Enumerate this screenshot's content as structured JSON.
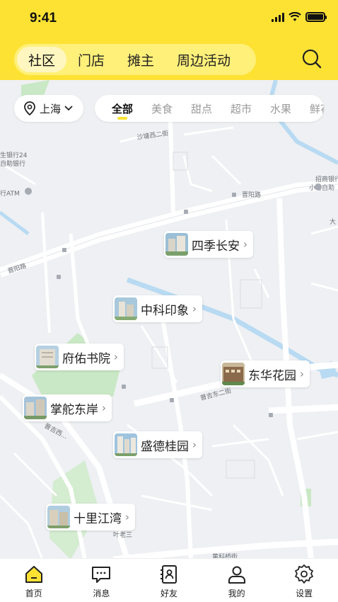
{
  "status_bar": {
    "time": "9:41"
  },
  "top_tabs": [
    {
      "label": "社区",
      "active": true
    },
    {
      "label": "门店",
      "active": false
    },
    {
      "label": "摊主",
      "active": false
    },
    {
      "label": "周边活动",
      "active": false
    }
  ],
  "city_selector": {
    "label": "上海"
  },
  "categories": [
    {
      "label": "全部",
      "active": true
    },
    {
      "label": "美食",
      "active": false
    },
    {
      "label": "甜点",
      "active": false
    },
    {
      "label": "超市",
      "active": false
    },
    {
      "label": "水果",
      "active": false
    },
    {
      "label": "鲜花",
      "active": false
    }
  ],
  "communities": [
    {
      "name": "四季长安"
    },
    {
      "name": "中科印象"
    },
    {
      "name": "府佑书院"
    },
    {
      "name": "东华花园"
    },
    {
      "name": "掌舵东岸"
    },
    {
      "name": "盛德桂园"
    },
    {
      "name": "十里江湾"
    }
  ],
  "map_labels": {
    "bank1": "生银行24",
    "bank1b": "自助银行",
    "atm": "行ATM",
    "bank2": "招商银行",
    "bank2b": "小时自助",
    "road_jinyang1": "晋阳路",
    "road_jinyang2": "晋阳路",
    "road_shaxi": "沙塘西二街",
    "road_yebai": "叶老三",
    "road_dongerjie": "普吉东二街",
    "road_xiaoxi": "晋吉西...",
    "road_bottom": "黄科桥街",
    "da": "大"
  },
  "bottom_nav": [
    {
      "label": "首页",
      "icon": "home-icon",
      "active": true
    },
    {
      "label": "消息",
      "icon": "message-icon",
      "active": false
    },
    {
      "label": "好友",
      "icon": "contacts-icon",
      "active": false
    },
    {
      "label": "我的",
      "icon": "user-icon",
      "active": false
    },
    {
      "label": "设置",
      "icon": "settings-icon",
      "active": false
    }
  ],
  "colors": {
    "brand_yellow": "#fde234",
    "water": "#b8daf2",
    "park": "#c9e8c5"
  }
}
